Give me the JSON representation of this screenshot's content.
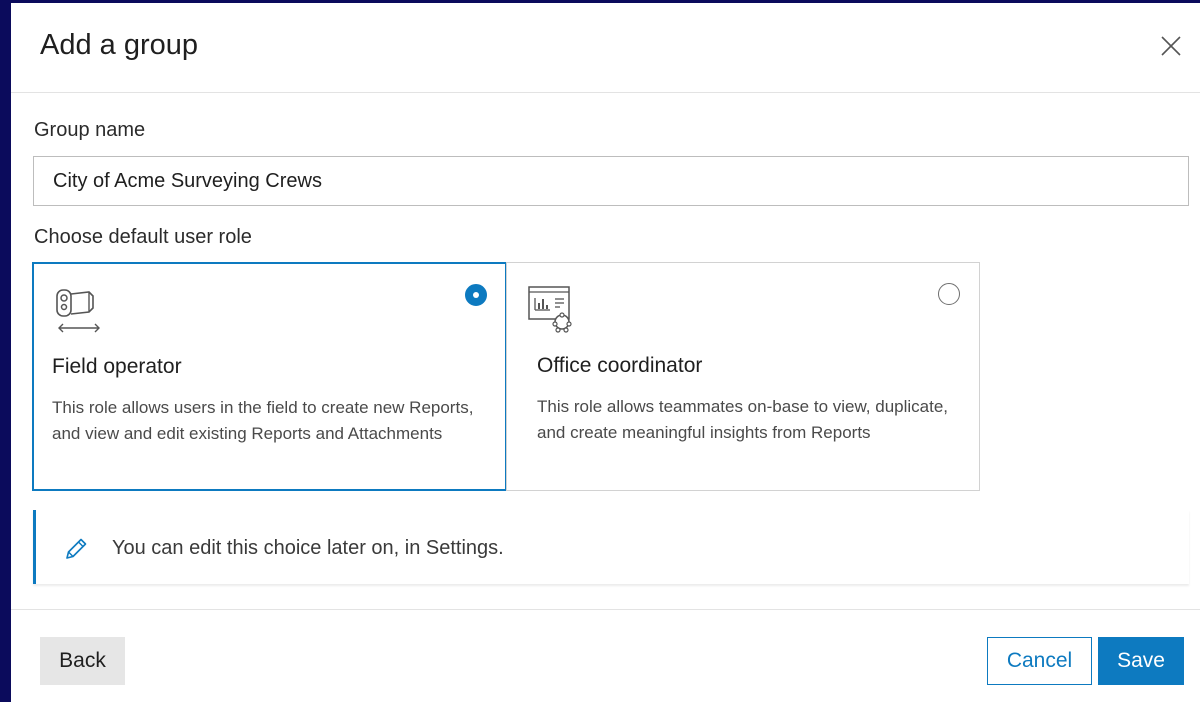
{
  "dialog": {
    "title": "Add a group",
    "close_icon": "close-icon"
  },
  "group_name": {
    "label": "Group name",
    "value": "City of Acme Surveying Crews"
  },
  "role": {
    "label": "Choose default user role",
    "options": [
      {
        "title": "Field operator",
        "description": "This role allows users in the field to create new Reports, and view and edit existing Reports and Attachments",
        "icon": "rangefinder-icon",
        "selected": true
      },
      {
        "title": "Office coordinator",
        "description": "This role allows teammates on-base to view, duplicate, and create meaningful insights from Reports",
        "icon": "report-insights-icon",
        "selected": false
      }
    ]
  },
  "info": {
    "icon": "pencil-icon",
    "text": "You can edit this choice later on, in Settings."
  },
  "footer": {
    "back_label": "Back",
    "cancel_label": "Cancel",
    "save_label": "Save"
  },
  "colors": {
    "accent": "#0d7ac0",
    "backdrop": "#0b0b5c"
  }
}
